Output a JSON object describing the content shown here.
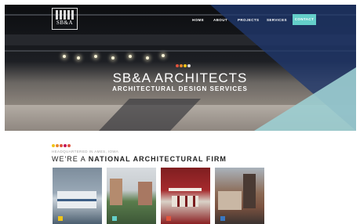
{
  "brand": {
    "logo_text": "SB&A"
  },
  "nav": {
    "items": [
      {
        "label": "HOME"
      },
      {
        "label": "ABOUT"
      },
      {
        "label": "PROJECTS"
      },
      {
        "label": "SERVICES"
      }
    ],
    "contact_label": "CONTACT"
  },
  "hero": {
    "title": "SB&A ARCHITECTS",
    "subtitle": "ARCHITECTURAL DESIGN SERVICES",
    "dot_colors": [
      "#e0533d",
      "#e88a2e",
      "#f0c419",
      "#d9d9d9"
    ]
  },
  "intro": {
    "kicker": "HEADQUARTERED IN AMES, IOWA",
    "title_plain": "WE'RE A ",
    "title_bold": "NATIONAL ARCHITECTURAL FIRM",
    "dot_colors": [
      "#f0c419",
      "#e88a2e",
      "#e0533d",
      "#c2185b",
      "#e0533d"
    ]
  },
  "projects": [
    {
      "accent": "#f0c419"
    },
    {
      "accent": "#64cfc9"
    },
    {
      "accent": "#e0533d"
    },
    {
      "accent": "#3a78c2"
    }
  ],
  "colors": {
    "accent_teal": "#64cfc9",
    "overlay_blue": "#20396e"
  }
}
